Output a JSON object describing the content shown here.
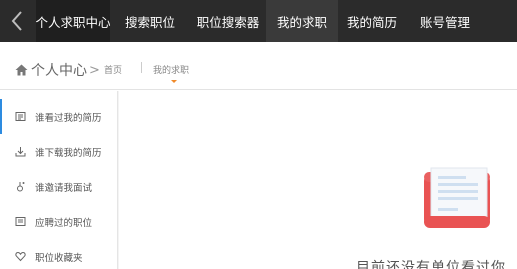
{
  "nav": {
    "items": [
      {
        "label": "个人求职中心"
      },
      {
        "label": "搜索职位"
      },
      {
        "label": "职位搜索器"
      },
      {
        "label": "我的求职"
      },
      {
        "label": "我的简历"
      },
      {
        "label": "账号管理"
      }
    ]
  },
  "breadcrumb": {
    "home_label": "个人中心",
    "arrow": ">",
    "first_link": "首页",
    "second_link": "我的求职"
  },
  "sidebar": {
    "items": [
      {
        "label": "谁看过我的简历",
        "icon": "resume-icon"
      },
      {
        "label": "谁下载我的简历",
        "icon": "download-icon"
      },
      {
        "label": "谁邀请我面试",
        "icon": "invite-icon"
      },
      {
        "label": "应聘过的职位",
        "icon": "applied-icon"
      },
      {
        "label": "职位收藏夹",
        "icon": "heart-icon"
      }
    ]
  },
  "main": {
    "empty_text": "目前还没有单位看过你"
  },
  "colors": {
    "nav_bg": "#2b2b2b",
    "accent": "#2d8be0",
    "caret": "#f08a2a",
    "illustration_red": "#e95353"
  }
}
